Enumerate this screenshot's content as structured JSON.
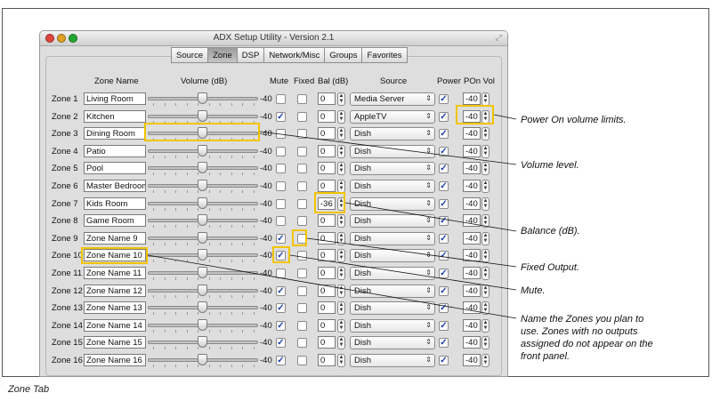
{
  "window": {
    "title": "ADX Setup Utility - Version 2.1"
  },
  "tabs": [
    "Source",
    "Zone",
    "DSP",
    "Network/Misc",
    "Groups",
    "Favorites"
  ],
  "columns": {
    "zone_name": "Zone Name",
    "volume": "Volume (dB)",
    "mute": "Mute",
    "fixed": "Fixed",
    "bal": "Bal (dB)",
    "source": "Source",
    "power": "Power",
    "pon_vol": "POn Vol"
  },
  "zones": [
    {
      "label": "Zone 1",
      "name": "Living Room",
      "volume": "-40",
      "mute": false,
      "fixed": false,
      "bal": "0",
      "source": "Media Server",
      "power": true,
      "pon_vol": "-40"
    },
    {
      "label": "Zone 2",
      "name": "Kitchen",
      "volume": "-40",
      "mute": true,
      "fixed": false,
      "bal": "0",
      "source": "AppleTV",
      "power": true,
      "pon_vol": "-40"
    },
    {
      "label": "Zone 3",
      "name": "Dining Room",
      "volume": "-40",
      "mute": false,
      "fixed": false,
      "bal": "0",
      "source": "Dish",
      "power": true,
      "pon_vol": "-40"
    },
    {
      "label": "Zone 4",
      "name": "Patio",
      "volume": "-40",
      "mute": false,
      "fixed": false,
      "bal": "0",
      "source": "Dish",
      "power": true,
      "pon_vol": "-40"
    },
    {
      "label": "Zone 5",
      "name": "Pool",
      "volume": "-40",
      "mute": false,
      "fixed": false,
      "bal": "0",
      "source": "Dish",
      "power": true,
      "pon_vol": "-40"
    },
    {
      "label": "Zone 6",
      "name": "Master Bedroom",
      "volume": "-40",
      "mute": false,
      "fixed": false,
      "bal": "0",
      "source": "Dish",
      "power": true,
      "pon_vol": "-40"
    },
    {
      "label": "Zone 7",
      "name": "Kids Room",
      "volume": "-40",
      "mute": false,
      "fixed": false,
      "bal": "-36",
      "source": "Dish",
      "power": true,
      "pon_vol": "-40"
    },
    {
      "label": "Zone 8",
      "name": "Game Room",
      "volume": "-40",
      "mute": false,
      "fixed": false,
      "bal": "0",
      "source": "Dish",
      "power": true,
      "pon_vol": "-40"
    },
    {
      "label": "Zone 9",
      "name": "Zone Name 9",
      "volume": "-40",
      "mute": true,
      "fixed": false,
      "bal": "0",
      "source": "Dish",
      "power": true,
      "pon_vol": "-40"
    },
    {
      "label": "Zone 10",
      "name": "Zone Name 10",
      "volume": "-40",
      "mute": true,
      "fixed": false,
      "bal": "0",
      "source": "Dish",
      "power": true,
      "pon_vol": "-40"
    },
    {
      "label": "Zone 11",
      "name": "Zone Name 11",
      "volume": "-40",
      "mute": false,
      "fixed": false,
      "bal": "0",
      "source": "Dish",
      "power": true,
      "pon_vol": "-40"
    },
    {
      "label": "Zone 12",
      "name": "Zone Name 12",
      "volume": "-40",
      "mute": true,
      "fixed": false,
      "bal": "0",
      "source": "Dish",
      "power": true,
      "pon_vol": "-40"
    },
    {
      "label": "Zone 13",
      "name": "Zone Name 13",
      "volume": "-40",
      "mute": true,
      "fixed": false,
      "bal": "0",
      "source": "Dish",
      "power": true,
      "pon_vol": "-40"
    },
    {
      "label": "Zone 14",
      "name": "Zone Name 14",
      "volume": "-40",
      "mute": true,
      "fixed": false,
      "bal": "0",
      "source": "Dish",
      "power": true,
      "pon_vol": "-40"
    },
    {
      "label": "Zone 15",
      "name": "Zone Name 15",
      "volume": "-40",
      "mute": true,
      "fixed": false,
      "bal": "0",
      "source": "Dish",
      "power": true,
      "pon_vol": "-40"
    },
    {
      "label": "Zone 16",
      "name": "Zone Name 16",
      "volume": "-40",
      "mute": true,
      "fixed": false,
      "bal": "0",
      "source": "Dish",
      "power": true,
      "pon_vol": "-40"
    }
  ],
  "callouts": [
    "Power On volume limits.",
    "Volume level.",
    "Balance (dB).",
    "Fixed Output.",
    "Mute.",
    "Name the Zones you plan to use. Zones with no outputs assigned do not appear on the front panel."
  ],
  "caption": "Zone Tab",
  "colors": {
    "highlight": "#f1c400",
    "check": "#1a3fb0",
    "window_bg": "#dedede"
  }
}
